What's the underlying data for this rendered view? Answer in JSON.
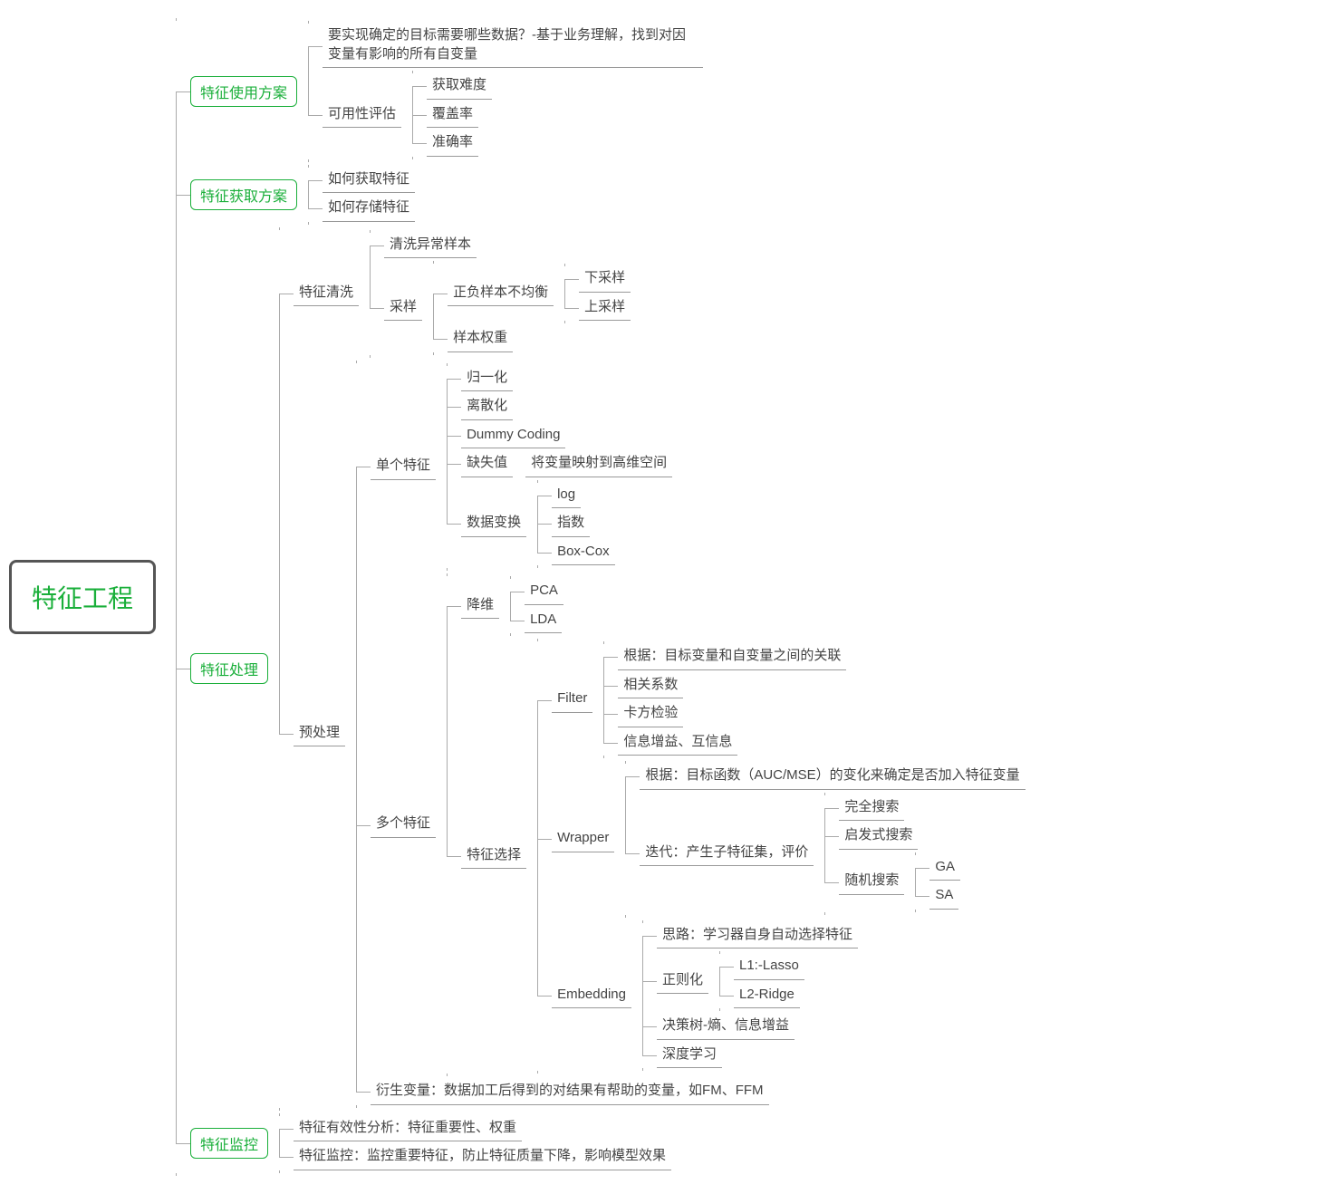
{
  "root": "特征工程",
  "b1": {
    "title": "特征使用方案",
    "goal": "要实现确定的目标需要哪些数据？-基于业务理解，找到对因变量有影响的所有自变量",
    "avail": "可用性评估",
    "a1": "获取难度",
    "a2": "覆盖率",
    "a3": "准确率"
  },
  "b2": {
    "title": "特征获取方案",
    "c1": "如何获取特征",
    "c2": "如何存储特征"
  },
  "b3": {
    "title": "特征处理",
    "clean": {
      "title": "特征清洗",
      "c1": "清洗异常样本",
      "sample": "采样",
      "imb": "正负样本不均衡",
      "down": "下采样",
      "up": "上采样",
      "weight": "样本权重"
    },
    "pre": {
      "title": "预处理",
      "single": {
        "title": "单个特征",
        "norm": "归一化",
        "disc": "离散化",
        "dummy": "Dummy Coding",
        "missing": "缺失值",
        "missing_note": "将变量映射到高维空间",
        "trans": "数据变换",
        "t1": "log",
        "t2": "指数",
        "t3": "Box-Cox"
      },
      "multi": {
        "title": "多个特征",
        "dimred": "降维",
        "pca": "PCA",
        "lda": "LDA",
        "select": "特征选择",
        "filter": {
          "title": "Filter",
          "f1": "根据：目标变量和自变量之间的关联",
          "f2": "相关系数",
          "f3": "卡方检验",
          "f4": "信息增益、互信息"
        },
        "wrapper": {
          "title": "Wrapper",
          "w1": "根据：目标函数（AUC/MSE）的变化来确定是否加入特征变量",
          "iter": "迭代：产生子特征集，评价",
          "s1": "完全搜索",
          "s2": "启发式搜索",
          "s3": "随机搜索",
          "ga": "GA",
          "sa": "SA"
        },
        "embed": {
          "title": "Embedding",
          "e1": "思路：学习器自身自动选择特征",
          "reg": "正则化",
          "l1": "L1:-Lasso",
          "l2": "L2-Ridge",
          "tree": "决策树-熵、信息增益",
          "deep": "深度学习"
        }
      },
      "derive": "衍生变量：数据加工后得到的对结果有帮助的变量，如FM、FFM"
    }
  },
  "b4": {
    "title": "特征监控",
    "m1": "特征有效性分析：特征重要性、权重",
    "m2": "特征监控：监控重要特征，防止特征质量下降，影响模型效果"
  }
}
